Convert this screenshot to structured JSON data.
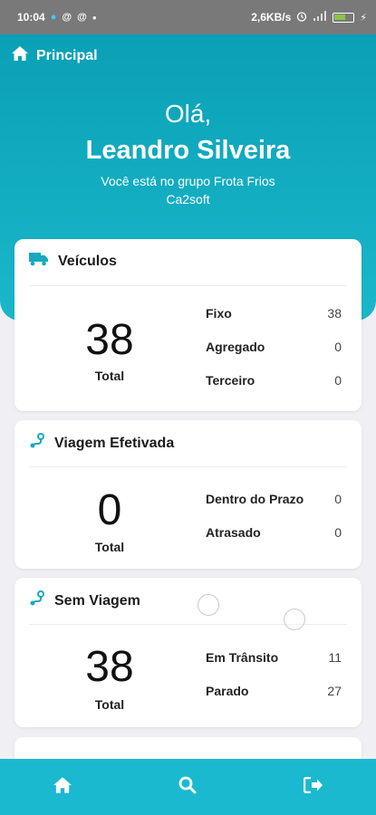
{
  "status_bar": {
    "time": "10:04",
    "network_speed": "2,6KB/s",
    "icons": [
      "notification-dot-icon",
      "at-icon",
      "at-icon",
      "dot-icon",
      "alarm-icon",
      "signal-icon",
      "battery-icon"
    ]
  },
  "header": {
    "title": "Principal",
    "title_icon": "home-icon",
    "greeting": "Olá,",
    "user_name": "Leandro Silveira",
    "group_text": "Você está no grupo Frota Frios",
    "company": "Ca2soft"
  },
  "cards": {
    "veiculos": {
      "title": "Veículos",
      "icon": "truck-icon",
      "total_value": "38",
      "total_label": "Total",
      "rows": [
        {
          "label": "Fixo",
          "value": "38"
        },
        {
          "label": "Agregado",
          "value": "0"
        },
        {
          "label": "Terceiro",
          "value": "0"
        }
      ]
    },
    "viagem_efetivada": {
      "title": "Viagem Efetivada",
      "icon": "route-icon",
      "total_value": "0",
      "total_label": "Total",
      "rows": [
        {
          "label": "Dentro do Prazo",
          "value": "0"
        },
        {
          "label": "Atrasado",
          "value": "0"
        }
      ]
    },
    "sem_viagem": {
      "title": "Sem Viagem",
      "icon": "route-icon",
      "total_value": "38",
      "total_label": "Total",
      "rows": [
        {
          "label": "Em Trânsito",
          "value": "11"
        },
        {
          "label": "Parado",
          "value": "27"
        }
      ]
    }
  },
  "bottom_nav": [
    {
      "icon": "home-icon"
    },
    {
      "icon": "search-icon"
    },
    {
      "icon": "logout-icon"
    }
  ],
  "colors": {
    "primary": "#1ab9cf",
    "header_dark": "#0aa0b5",
    "background": "#f0eff4",
    "status_bar": "#797979"
  }
}
